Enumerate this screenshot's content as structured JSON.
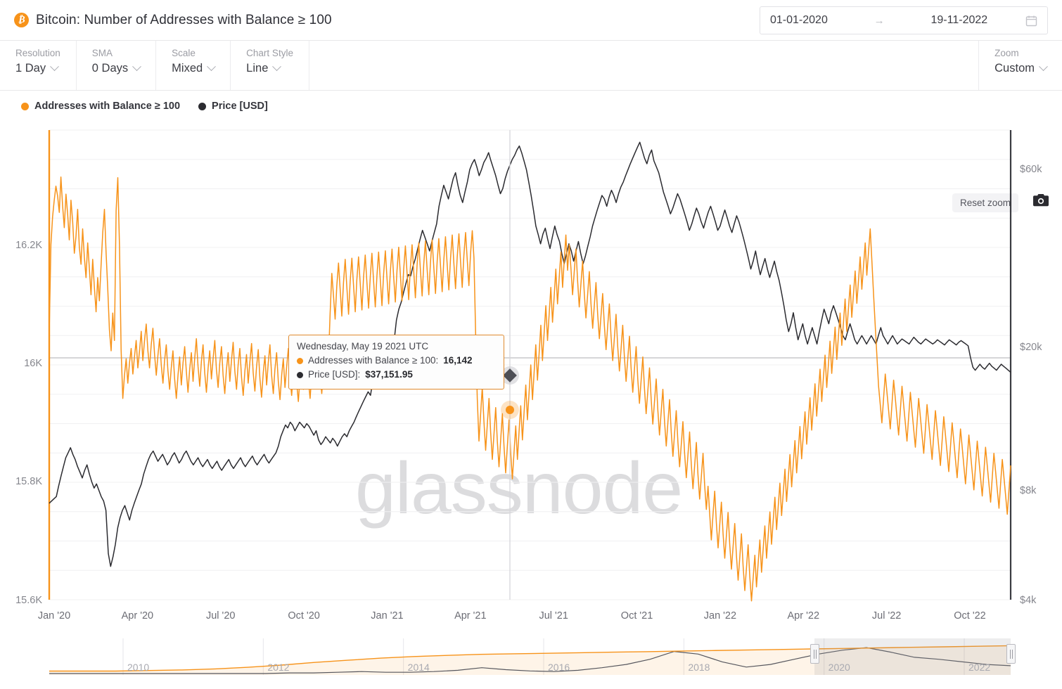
{
  "header": {
    "asset_icon": "bitcoin-icon",
    "title": "Bitcoin: Number of Addresses with Balance ≥ 100",
    "date_from": "01-01-2020",
    "date_arrow": "→",
    "date_to": "19-11-2022",
    "calendar_icon": "calendar-icon"
  },
  "toolbar": {
    "resolution_label": "Resolution",
    "resolution_value": "1 Day",
    "sma_label": "SMA",
    "sma_value": "0 Days",
    "scale_label": "Scale",
    "scale_value": "Mixed",
    "chart_style_label": "Chart Style",
    "chart_style_value": "Line",
    "zoom_label": "Zoom",
    "zoom_value": "Custom"
  },
  "legend": {
    "series_a": "Addresses with Balance ≥ 100",
    "series_b": "Price [USD]",
    "reset_zoom": "Reset zoom",
    "camera_icon": "camera-icon"
  },
  "watermark": "glassnode",
  "tooltip": {
    "date": "Wednesday, May 19 2021 UTC",
    "row_a_label": "Addresses with Balance ≥ 100:",
    "row_a_value": "16,142",
    "row_b_label": "Price [USD]:",
    "row_b_value": "$37,151.95"
  },
  "colors": {
    "addresses": "#f7931a",
    "price": "#2b2b30",
    "tooltip_border": "#e08a2e",
    "watermark": "#dcdcde",
    "grid": "#f0f0f2"
  },
  "chart_data": {
    "type": "line",
    "title": "Bitcoin: Number of Addresses with Balance ≥ 100",
    "xlabel": "",
    "ylabel_left": "Addresses with Balance ≥ 100",
    "ylabel_right": "Price [USD]",
    "x_range": [
      "2020-01-01",
      "2022-11-19"
    ],
    "x_tick_labels": [
      "Jan '20",
      "Apr '20",
      "Jul '20",
      "Oct '20",
      "Jan '21",
      "Apr '21",
      "Jul '21",
      "Oct '21",
      "Jan '22",
      "Apr '22",
      "Jul '22",
      "Oct '22"
    ],
    "y_left_ticks": [
      "15.6K",
      "15.8K",
      "16K",
      "16.2K"
    ],
    "y_left_range": [
      15550,
      16320
    ],
    "y_left_scale": "linear",
    "y_right_ticks": [
      "$4k",
      "$8k",
      "$20k",
      "$60k"
    ],
    "y_right_range": [
      4000,
      70000
    ],
    "y_right_scale": "log",
    "grid": true,
    "legend_position": "top-left",
    "crosshair": {
      "date": "2021-05-19",
      "addresses": 16142,
      "price": 37151.95
    },
    "series": [
      {
        "name": "Addresses with Balance ≥ 100",
        "color": "#f7931a",
        "axis": "left",
        "values": [
          15988,
          16132,
          16178,
          16205,
          16228,
          16212,
          16185,
          16243,
          16196,
          16160,
          16215,
          16182,
          16140,
          16205,
          16170,
          16118,
          16145,
          16190,
          16128,
          16100,
          16158,
          16112,
          16078,
          16135,
          16092,
          16050,
          16108,
          16062,
          16022,
          16078,
          16040,
          16098,
          16152,
          16190,
          16120,
          16060,
          15992,
          15958,
          16020,
          15975,
          16188,
          16242,
          16130,
          15960,
          15880,
          15918,
          15945,
          15905,
          15938,
          15962,
          15920,
          15948,
          15975,
          15930,
          15958,
          15990,
          15942,
          15975,
          16002,
          15958,
          15930,
          15968,
          15995,
          15952,
          15918,
          15950,
          15978,
          15935,
          15905,
          15942,
          15968,
          15925,
          15895,
          15930,
          15958,
          15912,
          15880,
          15918,
          15948,
          15902,
          15938,
          15965,
          15925,
          15890,
          15928,
          15955,
          15908,
          15945,
          15978,
          15932,
          15900,
          15940,
          15968,
          15922,
          15890,
          15930,
          15958,
          15912,
          15945,
          15975,
          15928,
          15898,
          15938,
          15965,
          15918,
          15888,
          15928,
          15955,
          15908,
          15942,
          15972,
          15925,
          15895,
          15935,
          15962,
          15915,
          15885,
          15925,
          15952,
          15905,
          15940,
          15970,
          15922,
          15892,
          15932,
          15960,
          15912,
          15882,
          15922,
          15950,
          15902,
          15938,
          15968,
          15918,
          15888,
          15928,
          15955,
          15908,
          15878,
          15918,
          15945,
          15898,
          15932,
          15962,
          15915,
          15885,
          15925,
          15952,
          15905,
          15875,
          15915,
          15942,
          15895,
          15930,
          15958,
          15910,
          15880,
          15920,
          15948,
          15900,
          15935,
          15965,
          15918,
          15888,
          15928,
          15955,
          15908,
          15942,
          16020,
          16085,
          16048,
          16010,
          16065,
          16102,
          16058,
          16015,
          16070,
          16108,
          16062,
          16018,
          16072,
          16110,
          16065,
          16022,
          16075,
          16112,
          16068,
          16025,
          16078,
          16115,
          16070,
          16028,
          16080,
          16118,
          16072,
          16030,
          16082,
          16120,
          16075,
          16032,
          16085,
          16122,
          16078,
          16035,
          16088,
          16125,
          16080,
          16038,
          16090,
          16128,
          16082,
          16040,
          16092,
          16130,
          16085,
          16042,
          16095,
          16132,
          16088,
          16045,
          16098,
          16135,
          16090,
          16048,
          16100,
          16138,
          16092,
          16050,
          16102,
          16140,
          16095,
          16052,
          16105,
          16142,
          16098,
          16055,
          16108,
          16145,
          16100,
          16058,
          16110,
          16148,
          16102,
          16060,
          16112,
          16150,
          16105,
          16062,
          16115,
          16152,
          16108,
          16065,
          16118,
          16155,
          16110,
          15990,
          15880,
          15810,
          15855,
          15898,
          15842,
          15795,
          15838,
          15880,
          15825,
          15780,
          15822,
          15865,
          15810,
          15768,
          15812,
          15855,
          15800,
          15758,
          15802,
          15845,
          15790,
          15748,
          15792,
          15835,
          15780,
          15825,
          15868,
          15812,
          15858,
          15902,
          15845,
          15890,
          15935,
          15878,
          15922,
          15968,
          15910,
          15955,
          16000,
          15942,
          15988,
          16032,
          15975,
          16018,
          16062,
          16005,
          16048,
          16092,
          16035,
          16078,
          16120,
          16062,
          16105,
          16148,
          16090,
          16132,
          16095,
          16050,
          16088,
          16125,
          16072,
          16030,
          16068,
          16105,
          16052,
          16012,
          16050,
          16088,
          16035,
          15995,
          16032,
          16070,
          16018,
          15978,
          16015,
          16052,
          16000,
          15960,
          15998,
          16035,
          15982,
          15942,
          15980,
          16018,
          15965,
          15925,
          15962,
          16000,
          15948,
          15908,
          15945,
          15982,
          15930,
          15890,
          15928,
          15965,
          15912,
          15872,
          15910,
          15948,
          15895,
          15855,
          15892,
          15930,
          15878,
          15838,
          15875,
          15912,
          15860,
          15820,
          15858,
          15895,
          15842,
          15802,
          15840,
          15878,
          15825,
          15785,
          15822,
          15860,
          15808,
          15768,
          15805,
          15842,
          15790,
          15750,
          15788,
          15825,
          15772,
          15732,
          15770,
          15808,
          15755,
          15715,
          15752,
          15790,
          15738,
          15698,
          15736,
          15690,
          15648,
          15690,
          15728,
          15675,
          15635,
          15672,
          15710,
          15658,
          15618,
          15655,
          15693,
          15640,
          15600,
          15638,
          15675,
          15622,
          15582,
          15620,
          15658,
          15605,
          15565,
          15603,
          15640,
          15588,
          15548,
          15586,
          15623,
          15571,
          15610,
          15648,
          15595,
          15633,
          15671,
          15618,
          15656,
          15694,
          15641,
          15680,
          15718,
          15665,
          15703,
          15741,
          15688,
          15726,
          15764,
          15711,
          15750,
          15788,
          15735,
          15773,
          15811,
          15758,
          15796,
          15834,
          15781,
          15820,
          15858,
          15805,
          15843,
          15881,
          15828,
          15866,
          15904,
          15851,
          15890,
          15928,
          15875,
          15913,
          15951,
          15898,
          15936,
          15974,
          15921,
          15959,
          15997,
          15944,
          15982,
          16020,
          15967,
          16005,
          16043,
          15990,
          16028,
          16066,
          16013,
          16051,
          16089,
          16036,
          16074,
          16112,
          16059,
          16097,
          16135,
          16082,
          16120,
          16158,
          16105,
          16050,
          16000,
          15950,
          15900,
          15870,
          15840,
          15880,
          15920,
          15890,
          15860,
          15830,
          15870,
          15910,
          15880,
          15850,
          15820,
          15860,
          15900,
          15870,
          15840,
          15810,
          15850,
          15890,
          15860,
          15830,
          15800,
          15840,
          15880,
          15850,
          15820,
          15790,
          15830,
          15870,
          15840,
          15810,
          15780,
          15820,
          15860,
          15830,
          15800,
          15770,
          15810,
          15850,
          15820,
          15790,
          15760,
          15800,
          15840,
          15810,
          15780,
          15750,
          15790,
          15830,
          15800,
          15770,
          15740,
          15780,
          15820,
          15790,
          15760,
          15730,
          15770,
          15810,
          15780,
          15750,
          15720,
          15760,
          15800,
          15770,
          15740,
          15710,
          15750,
          15790,
          15760,
          15730,
          15700,
          15740,
          15780,
          15750,
          15720,
          15690,
          15730,
          15770
        ]
      },
      {
        "name": "Price [USD]",
        "color": "#2b2b30",
        "axis": "right",
        "values": [
          7200,
          7300,
          7400,
          7500,
          8000,
          8500,
          9000,
          9500,
          9800,
          10100,
          9700,
          9400,
          9000,
          8700,
          8400,
          8800,
          9100,
          8600,
          8200,
          7900,
          8100,
          7800,
          7500,
          7300,
          6900,
          5300,
          4900,
          5200,
          5600,
          6200,
          6600,
          6900,
          7100,
          6800,
          6500,
          6900,
          7200,
          7500,
          7800,
          8100,
          8600,
          9000,
          9400,
          9700,
          9900,
          9600,
          9300,
          9500,
          9700,
          9400,
          9100,
          9300,
          9600,
          9800,
          9500,
          9200,
          9400,
          9700,
          9900,
          9600,
          9300,
          9100,
          9300,
          9500,
          9200,
          9000,
          9200,
          9400,
          9100,
          8900,
          9100,
          9300,
          9000,
          8800,
          9000,
          9200,
          9400,
          9100,
          8900,
          9100,
          9300,
          9500,
          9200,
          9000,
          9200,
          9400,
          9600,
          9300,
          9100,
          9300,
          9500,
          9700,
          9400,
          9200,
          9400,
          9600,
          9800,
          10200,
          10800,
          11200,
          11600,
          11400,
          11800,
          11600,
          11200,
          11500,
          11800,
          11600,
          11400,
          11700,
          11500,
          11200,
          10900,
          11200,
          10600,
          10300,
          10500,
          10800,
          10600,
          10400,
          10700,
          10500,
          10200,
          10500,
          10800,
          11000,
          10800,
          11200,
          11500,
          11800,
          12200,
          12600,
          13000,
          13400,
          13800,
          14200,
          13900,
          15200,
          15800,
          16400,
          16900,
          17500,
          18200,
          18800,
          19200,
          18600,
          19400,
          22000,
          23500,
          24500,
          26000,
          27500,
          29000,
          28800,
          30500,
          32000,
          34000,
          36000,
          38000,
          36500,
          35000,
          33500,
          35500,
          37500,
          39500,
          44000,
          47000,
          50000,
          48000,
          46000,
          49000,
          52000,
          54000,
          50000,
          47000,
          45000,
          48000,
          51000,
          55000,
          57000,
          58500,
          56000,
          53000,
          55000,
          57500,
          59000,
          61000,
          58000,
          55500,
          53000,
          50000,
          47500,
          49000,
          52000,
          54500,
          56500,
          58500,
          60000,
          62000,
          63500,
          61000,
          58000,
          55000,
          51000,
          47000,
          43000,
          39000,
          37000,
          35000,
          37152,
          38500,
          36000,
          34000,
          36500,
          39000,
          37000,
          35500,
          33000,
          31000,
          33000,
          35000,
          33500,
          31500,
          33500,
          35500,
          33000,
          31000,
          32500,
          34500,
          36500,
          39000,
          41000,
          43000,
          45000,
          47000,
          46000,
          44000,
          46500,
          48500,
          47000,
          45000,
          47500,
          49500,
          51000,
          53000,
          55000,
          57000,
          59000,
          61000,
          63000,
          65000,
          62000,
          59000,
          57000,
          60000,
          62000,
          58000,
          56000,
          54000,
          51000,
          48000,
          46000,
          44000,
          42000,
          43500,
          45500,
          47500,
          46000,
          44000,
          42000,
          40000,
          38000,
          39500,
          41500,
          43500,
          42000,
          40000,
          38500,
          40500,
          42500,
          44000,
          42000,
          40000,
          38000,
          39000,
          41000,
          43000,
          41000,
          39000,
          37500,
          39500,
          41500,
          40000,
          38000,
          36000,
          34000,
          32000,
          30000,
          31500,
          33500,
          31000,
          29000,
          30500,
          32000,
          30000,
          28500,
          30000,
          31500,
          29500,
          28000,
          26000,
          24000,
          22000,
          20500,
          21500,
          23000,
          21000,
          19500,
          20500,
          21500,
          20000,
          19000,
          20000,
          21000,
          20000,
          19000,
          20500,
          22000,
          23500,
          22500,
          21500,
          23000,
          24000,
          23000,
          22000,
          21000,
          20000,
          19500,
          20500,
          21500,
          20500,
          19500,
          19000,
          19500,
          20000,
          19500,
          19000,
          19500,
          20000,
          19500,
          19000,
          20000,
          21000,
          20000,
          19500,
          19000,
          19500,
          20000,
          19500,
          19000,
          19300,
          19600,
          19400,
          19200,
          19000,
          19400,
          19800,
          19500,
          19200,
          19000,
          19300,
          19600,
          19400,
          19200,
          19000,
          19200,
          19500,
          19300,
          19100,
          18900,
          19200,
          19500,
          19300,
          19100,
          18900,
          19200,
          19400,
          19200,
          19000,
          18800,
          17500,
          16500,
          16200,
          16500,
          16800,
          16500,
          16300,
          16600,
          16900,
          16600,
          16400,
          16200,
          16500,
          16800,
          16600,
          16400,
          16200,
          16000
        ]
      }
    ]
  },
  "navigator": {
    "year_labels": [
      "2010",
      "2012",
      "2014",
      "2016",
      "2018",
      "2020",
      "2022"
    ],
    "selection_from": "2020",
    "selection_to": "2022"
  }
}
